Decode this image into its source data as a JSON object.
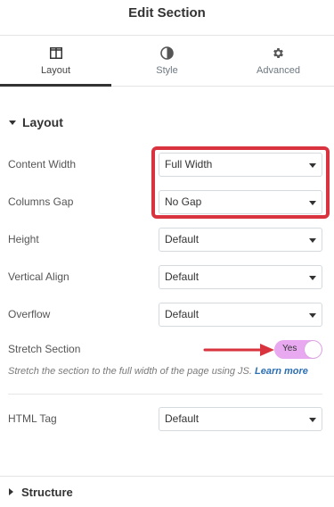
{
  "header": {
    "title": "Edit Section"
  },
  "tabs": [
    {
      "label": "Layout",
      "icon": "columns-icon",
      "active": true
    },
    {
      "label": "Style",
      "icon": "contrast-icon",
      "active": false
    },
    {
      "label": "Advanced",
      "icon": "gear-icon",
      "active": false
    }
  ],
  "layout_section": {
    "title": "Layout",
    "expanded": true
  },
  "fields": {
    "content_width": {
      "label": "Content Width",
      "value": "Full Width"
    },
    "columns_gap": {
      "label": "Columns Gap",
      "value": "No Gap"
    },
    "height": {
      "label": "Height",
      "value": "Default"
    },
    "vertical_align": {
      "label": "Vertical Align",
      "value": "Default"
    },
    "overflow": {
      "label": "Overflow",
      "value": "Default"
    },
    "stretch_section": {
      "label": "Stretch Section",
      "toggle_text": "Yes",
      "on": true
    },
    "html_tag": {
      "label": "HTML Tag",
      "value": "Default"
    }
  },
  "stretch_description": {
    "text": "Stretch the section to the full width of the page using JS.",
    "link": "Learn more"
  },
  "structure_section": {
    "title": "Structure",
    "expanded": false
  },
  "colors": {
    "highlight": "#d8333e",
    "toggle_on": "#e8a9f0",
    "link": "#2d6fb3",
    "annotation_arrow": "#d8333e"
  }
}
